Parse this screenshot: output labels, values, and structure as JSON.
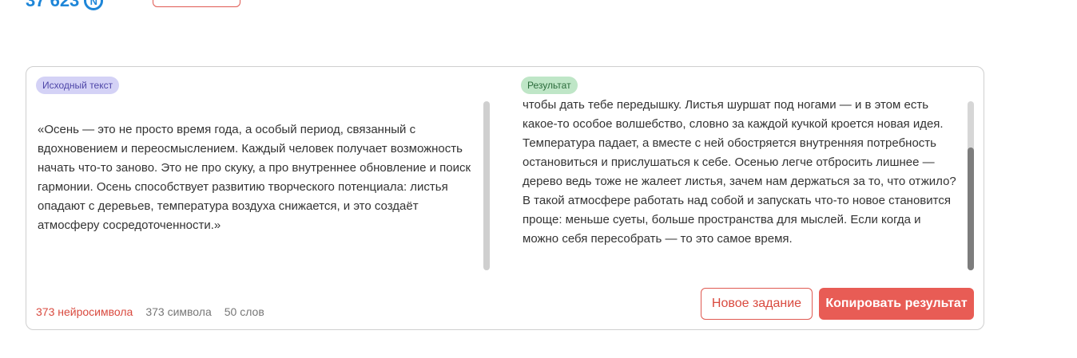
{
  "header": {
    "balance": "37 623",
    "balance_icon": "coin-n-icon",
    "balance_icon_glyph": "N"
  },
  "editor": {
    "source_tag": "Исходный текст",
    "result_tag": "Результат",
    "source_text": "«Осень — это не просто время года, а особый период, связанный с вдохновением и переосмыслением. Каждый человек получает возможность начать что-то заново. Это не про скуку, а про внутреннее обновление и поиск гармонии. Осень способствует развитию творческого потенциала: листья опадают с деревьев, температура воздуха снижается, и это создаёт атмосферу сосредоточенности.»",
    "result_text": "чтобы дать тебе передышку. Листья шуршат под ногами — и в этом есть какое-то особое волшебство, словно за каждой кучкой кроется новая идея. Температура падает, а вместе с ней обостряется внутренняя потребность остановиться и прислушаться к себе. Осенью легче отбросить лишнее — дерево ведь тоже не жалеет листья, зачем нам держаться за то, что отжило? В такой атмосфере работать над собой и запускать что-то новое становится проще: меньше суеты, больше пространства для мыслей. Если когда и можно себя пересобрать — то это самое время."
  },
  "stats": {
    "neuro_symbols": "373 нейросимвола",
    "symbols": "373 символа",
    "words": "50 слов"
  },
  "actions": {
    "new_task": "Новое задание",
    "copy_result": "Копировать результат"
  },
  "colors": {
    "accent": "#e85c55",
    "balance": "#1e86d8",
    "source_tag_bg": "#d4d2f6",
    "result_tag_bg": "#bfe6c7"
  }
}
